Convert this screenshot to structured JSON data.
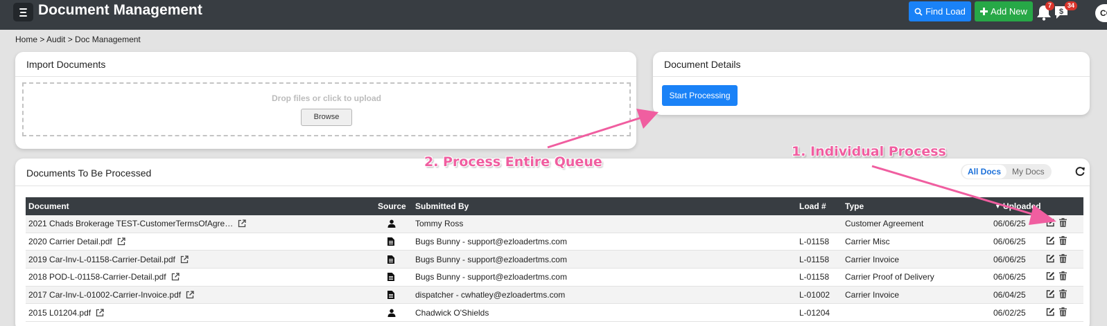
{
  "header": {
    "title": "Document Management",
    "find_load": "Find Load",
    "add_new": "Add New",
    "notif_count": "7",
    "msg_count": "34",
    "user_initials": "CC"
  },
  "breadcrumb": "Home > Audit > Doc Management",
  "import_card": {
    "title": "Import Documents",
    "drop_text": "Drop files or click to upload",
    "browse": "Browse"
  },
  "details_card": {
    "title": "Document Details",
    "start": "Start Processing"
  },
  "queue": {
    "title": "Documents To Be Processed",
    "toggle": [
      "All Docs",
      "My Docs"
    ],
    "columns": [
      "Document",
      "Source",
      "Submitted By",
      "Load #",
      "Type",
      "Uploaded"
    ],
    "rows": [
      {
        "document": "2021 Chads Brokerage TEST-CustomerTermsOfAgre…",
        "source": "person-icon",
        "submitted_by": "Tommy Ross",
        "load": "",
        "type": "Customer Agreement",
        "uploaded": "06/06/25"
      },
      {
        "document": "2020 Carrier Detail.pdf",
        "source": "document-icon",
        "submitted_by": "Bugs Bunny - support@ezloadertms.com",
        "load": "L-01158",
        "type": "Carrier Misc",
        "uploaded": "06/06/25"
      },
      {
        "document": "2019 Car-Inv-L-01158-Carrier-Detail.pdf",
        "source": "document-icon",
        "submitted_by": "Bugs Bunny - support@ezloadertms.com",
        "load": "L-01158",
        "type": "Carrier Invoice",
        "uploaded": "06/06/25"
      },
      {
        "document": "2018 POD-L-01158-Carrier-Detail.pdf",
        "source": "document-icon",
        "submitted_by": "Bugs Bunny - support@ezloadertms.com",
        "load": "L-01158",
        "type": "Carrier Proof of Delivery",
        "uploaded": "06/06/25"
      },
      {
        "document": "2017 Car-Inv-L-01002-Carrier-Invoice.pdf",
        "source": "document-icon",
        "submitted_by": "dispatcher - cwhatley@ezloadertms.com",
        "load": "L-01002",
        "type": "Carrier Invoice",
        "uploaded": "06/04/25"
      },
      {
        "document": "2015 L01204.pdf",
        "source": "person-icon",
        "submitted_by": "Chadwick O'Shields",
        "load": "L-01204",
        "type": "",
        "uploaded": "06/02/25"
      }
    ]
  },
  "annotations": {
    "queue": "2. Process Entire Queue",
    "individual": "1. Individual Process"
  },
  "colors": {
    "topbar": "#383d42",
    "primary": "#1a82f7",
    "success": "#27a847",
    "annotation": "#f05ea0"
  }
}
